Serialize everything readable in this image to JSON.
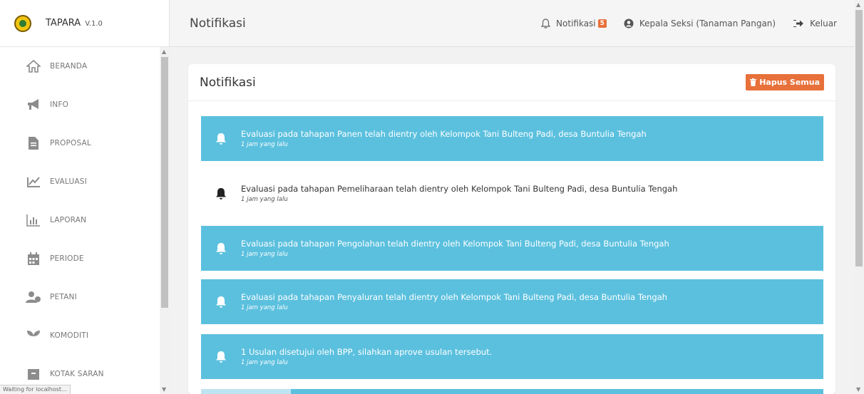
{
  "brand": {
    "name": "TAPARA",
    "version": "V.1.0"
  },
  "sidebar": {
    "items": [
      {
        "label": "BERANDA",
        "icon": "home-icon"
      },
      {
        "label": "INFO",
        "icon": "megaphone-icon"
      },
      {
        "label": "PROPOSAL",
        "icon": "document-icon"
      },
      {
        "label": "EVALUASI",
        "icon": "chart-pen-icon"
      },
      {
        "label": "LAPORAN",
        "icon": "bar-chart-icon"
      },
      {
        "label": "PERIODE",
        "icon": "calendar-icon"
      },
      {
        "label": "PETANI",
        "icon": "users-icon"
      },
      {
        "label": "KOMODITI",
        "icon": "plant-icon"
      },
      {
        "label": "KOTAK SARAN",
        "icon": "inbox-icon"
      }
    ]
  },
  "topbar": {
    "title": "Notifikasi",
    "notifications_label": "Notifikasi",
    "notifications_count": "5",
    "user_label": "Kepala Seksi (Tanaman Pangan)",
    "logout_label": "Keluar"
  },
  "card": {
    "title": "Notifikasi",
    "delete_all_label": "Hapus Semua"
  },
  "notifications": [
    {
      "message": "Evaluasi pada tahapan Panen telah dientry oleh Kelompok Tani Bulteng Padi, desa Buntulia Tengah",
      "time": "1 jam yang lalu",
      "read": false
    },
    {
      "message": "Evaluasi pada tahapan Pemeliharaan telah dientry oleh Kelompok Tani Bulteng Padi, desa Buntulia Tengah",
      "time": "1 jam yang lalu",
      "read": true
    },
    {
      "message": "Evaluasi pada tahapan Pengolahan telah dientry oleh Kelompok Tani Bulteng Padi, desa Buntulia Tengah",
      "time": "1 jam yang lalu",
      "read": false
    },
    {
      "message": "Evaluasi pada tahapan Penyaluran telah dientry oleh Kelompok Tani Bulteng Padi, desa Buntulia Tengah",
      "time": "1 jam yang lalu",
      "read": false
    },
    {
      "message": "1 Usulan disetujui oleh BPP, silahkan aprove usulan tersebut.",
      "time": "1 jam yang lalu",
      "read": false
    }
  ],
  "status_bar": "Waiting for localhost...",
  "colors": {
    "unread_bg": "#5bc0de",
    "accent": "#e8703a"
  }
}
